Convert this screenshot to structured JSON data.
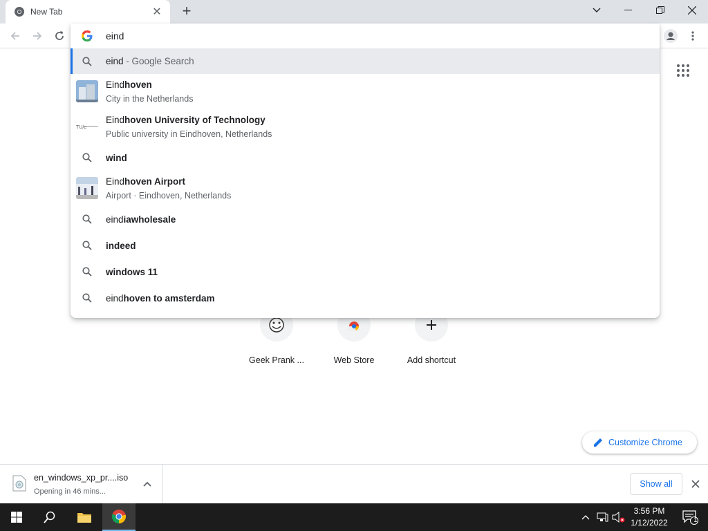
{
  "tab": {
    "title": "New Tab"
  },
  "omnibox": {
    "value": "eind",
    "suggestions": [
      {
        "type": "search",
        "prefix": "eind",
        "bold": "",
        "suffix": " - Google Search",
        "sub": ""
      },
      {
        "type": "entity",
        "prefix": "Eind",
        "bold": "hoven",
        "suffix": "",
        "sub": "City in the Netherlands"
      },
      {
        "type": "entity",
        "prefix": "Eind",
        "bold": "hoven University of Technology",
        "suffix": "",
        "sub": "Public university in Eindhoven, Netherlands"
      },
      {
        "type": "search",
        "prefix": "",
        "bold": "wind",
        "suffix": "",
        "sub": ""
      },
      {
        "type": "entity",
        "prefix": "Eind",
        "bold": "hoven Airport",
        "suffix": "",
        "sub": "Airport · Eindhoven, Netherlands"
      },
      {
        "type": "search",
        "prefix": "eind",
        "bold": "iawholesale",
        "suffix": "",
        "sub": ""
      },
      {
        "type": "search",
        "prefix": "",
        "bold": "indeed",
        "suffix": "",
        "sub": ""
      },
      {
        "type": "search",
        "prefix": "",
        "bold": "windows 11",
        "suffix": "",
        "sub": ""
      },
      {
        "type": "search",
        "prefix": "eind",
        "bold": "hoven to amsterdam",
        "suffix": "",
        "sub": ""
      }
    ]
  },
  "shortcuts": [
    {
      "label": "Geek Prank ..."
    },
    {
      "label": "Web Store"
    },
    {
      "label": "Add shortcut"
    }
  ],
  "customize": {
    "label": "Customize Chrome"
  },
  "download": {
    "filename": "en_windows_xp_pr....iso",
    "status": "Opening in 46 mins...",
    "show_all": "Show all"
  },
  "taskbar": {
    "time": "3:56 PM",
    "date": "1/12/2022",
    "notification_count": "1"
  },
  "colors": {
    "accent": "#1a73e8",
    "taskbar": "#1c1c1c",
    "tabstrip": "#dee1e6"
  }
}
